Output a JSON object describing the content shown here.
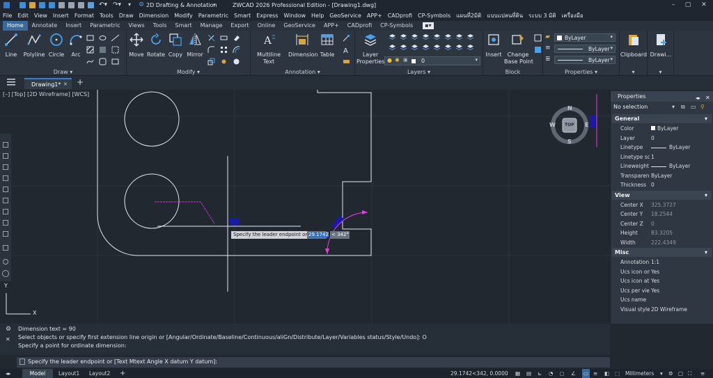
{
  "titlebar": {
    "workspace": "2D Drafting & Annotation",
    "title": "ZWCAD 2026 Professional Edition - [Drawing1.dwg]"
  },
  "menu": [
    "File",
    "Edit",
    "View",
    "Insert",
    "Format",
    "Tools",
    "Draw",
    "Dimension",
    "Modify",
    "Parametric",
    "Smart",
    "Express",
    "Window",
    "Help",
    "GeoService",
    "APP+",
    "CADprofi",
    "CP-Symbols",
    "แผนที่2มิติ",
    "แบบแปลนที่ดิน",
    "ระบบ 3 มิติ",
    "เครื่องมือ"
  ],
  "ribbon_tabs": [
    "Home",
    "Annotate",
    "Insert",
    "Parametric",
    "Views",
    "Tools",
    "Smart",
    "Manage",
    "Export",
    "Online",
    "GeoService",
    "APP+",
    "CADprofi",
    "CP-Symbols"
  ],
  "ribbon": {
    "draw": {
      "title": "Draw",
      "line": "Line",
      "polyline": "Polyline",
      "circle": "Circle",
      "arc": "Arc"
    },
    "modify": {
      "title": "Modify",
      "move": "Move",
      "rotate": "Rotate",
      "copy": "Copy",
      "mirror": "Mirror"
    },
    "annotation": {
      "title": "Annotation",
      "mtext_1": "Multiline",
      "mtext_2": "Text",
      "dimension": "Dimension",
      "table": "Table"
    },
    "layers": {
      "title": "Layers",
      "props_1": "Layer",
      "props_2": "Properties",
      "current": "0"
    },
    "block": {
      "title": "Block",
      "insert": "Insert",
      "change_1": "Change",
      "change_2": "Base Point"
    },
    "properties": {
      "title": "Properties",
      "color": "ByLayer",
      "linetype": "ByLayer",
      "lineweight": "ByLayer"
    },
    "clipboard": "Clipboard",
    "drawing": "Drawi..."
  },
  "doc_tab": "Drawing1*",
  "view_label": "[–] [Top] [2D Wireframe] [WCS]",
  "viewcube": {
    "n": "N",
    "s": "S",
    "e": "E",
    "w": "W",
    "top": "TOP"
  },
  "dynamic_input": {
    "prompt": "Specify the leader endpoint or",
    "value1": "29.1742",
    "value2": "< 342°"
  },
  "properties_palette": {
    "title": "Properties",
    "selection": "No selection",
    "sections": {
      "general": "General",
      "view": "View",
      "misc": "Misc"
    },
    "general_rows": [
      {
        "k": "Color",
        "v": "ByLayer"
      },
      {
        "k": "Layer",
        "v": "0"
      },
      {
        "k": "Linetype",
        "v": "ByLayer"
      },
      {
        "k": "Linetype sc...",
        "v": "1"
      },
      {
        "k": "Lineweight",
        "v": "ByLayer"
      },
      {
        "k": "Transparency",
        "v": "ByLayer"
      },
      {
        "k": "Thickness",
        "v": "0"
      }
    ],
    "view_rows": [
      {
        "k": "Center X",
        "v": "325.3727"
      },
      {
        "k": "Center Y",
        "v": "18.2544"
      },
      {
        "k": "Center Z",
        "v": "0"
      },
      {
        "k": "Height",
        "v": "83.3205"
      },
      {
        "k": "Width",
        "v": "222.4349"
      }
    ],
    "misc_rows": [
      {
        "k": "Annotation ...",
        "v": "1:1"
      },
      {
        "k": "Ucs icon on",
        "v": "Yes"
      },
      {
        "k": "Ucs icon at ...",
        "v": "Yes"
      },
      {
        "k": "Ucs per vie...",
        "v": "Yes"
      },
      {
        "k": "Ucs name",
        "v": ""
      },
      {
        "k": "Visual style",
        "v": "2D Wireframe"
      }
    ]
  },
  "command": {
    "history": [
      "Dimension text = 90",
      "Select objects or specify first extension line origin or [Angular/Ordinate/Baseline/Continuous/aliGn/Distribute/Layer/Variables status/Style/Undo]: O",
      "Specify a point for ordinate dimension:"
    ],
    "current": "Specify the leader endpoint or [Text Mtext Angle X datum Y datum]:"
  },
  "status": {
    "model": "Model",
    "layout1": "Layout1",
    "layout2": "Layout2",
    "coords": "29.1742<342, 0.0000",
    "units": "Millimeters"
  },
  "ucs": {
    "x": "X",
    "y": "Y"
  },
  "colors": {
    "accent": "#3b6a9a",
    "magenta": "#e040e0",
    "grip": "#1a1aa8"
  }
}
